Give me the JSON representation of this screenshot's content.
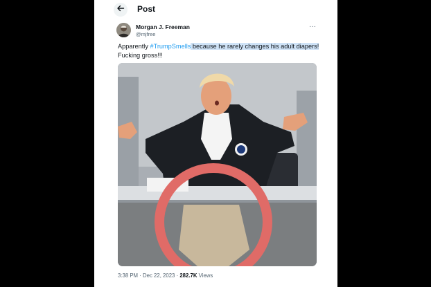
{
  "header": {
    "title": "Post",
    "back_icon": "arrow-left-icon"
  },
  "author": {
    "name": "Morgan J. Freeman",
    "handle": "@mjfree",
    "more_icon": "more-horizontal-icon",
    "more_label": "···"
  },
  "post": {
    "text_prefix": "Apparently ",
    "hashtag": "#TrumpSmells",
    "text_highlight": " because he rarely changes his adult diapers!",
    "text_line2": "Fucking gross!!!"
  },
  "meta": {
    "time": "3:38 PM",
    "separator": "·",
    "date": "Dec 22, 2023",
    "views_count": "282.7K",
    "views_label": "Views"
  },
  "colors": {
    "hashtag": "#1d9bf0",
    "highlight": "#cfe3f7",
    "circle": "#e06b67",
    "jacket": "#1c1f24"
  }
}
